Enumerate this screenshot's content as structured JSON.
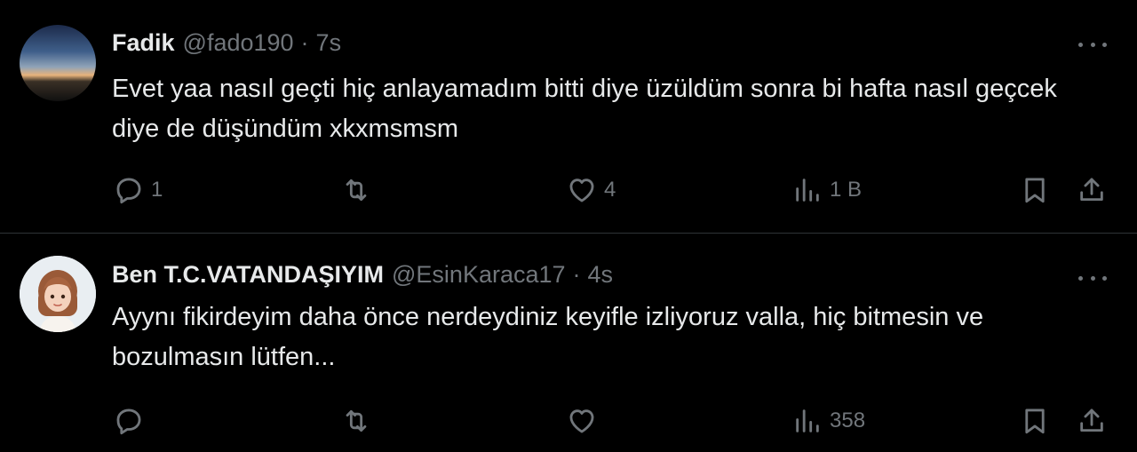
{
  "tweets": [
    {
      "name": "Fadik",
      "handle": "@fado190",
      "separator": "·",
      "time": "7s",
      "text": "Evet yaa nasıl geçti hiç anlayamadım bitti diye üzüldüm sonra bi hafta nasıl geçcek diye de düşündüm xkxmsmsm",
      "avatar": "sunset-sky-avatar",
      "counts": {
        "replies": "1",
        "retweets": "",
        "likes": "4",
        "views": "1 B"
      }
    },
    {
      "name": "Ben T.C.VATANDAŞIYIM",
      "handle": "@EsinKaraca17",
      "separator": "·",
      "time": "4s",
      "text": "Ayynı fikirdeyim daha önce nerdeydiniz keyifle izliyoruz valla, hiç bitmesin ve bozulmasın lütfen...",
      "avatar": "cartoon-girl-avatar",
      "counts": {
        "replies": "",
        "retweets": "",
        "likes": "",
        "views": "358"
      }
    }
  ],
  "icons": {
    "reply": "reply-icon",
    "retweet": "retweet-icon",
    "like": "heart-icon",
    "views": "views-chart-icon",
    "bookmark": "bookmark-icon",
    "share": "share-icon",
    "more": "more-dots-icon"
  },
  "colors": {
    "background": "#000000",
    "text": "#e7e9ea",
    "secondary": "#71767b",
    "divider": "#2f3336"
  }
}
